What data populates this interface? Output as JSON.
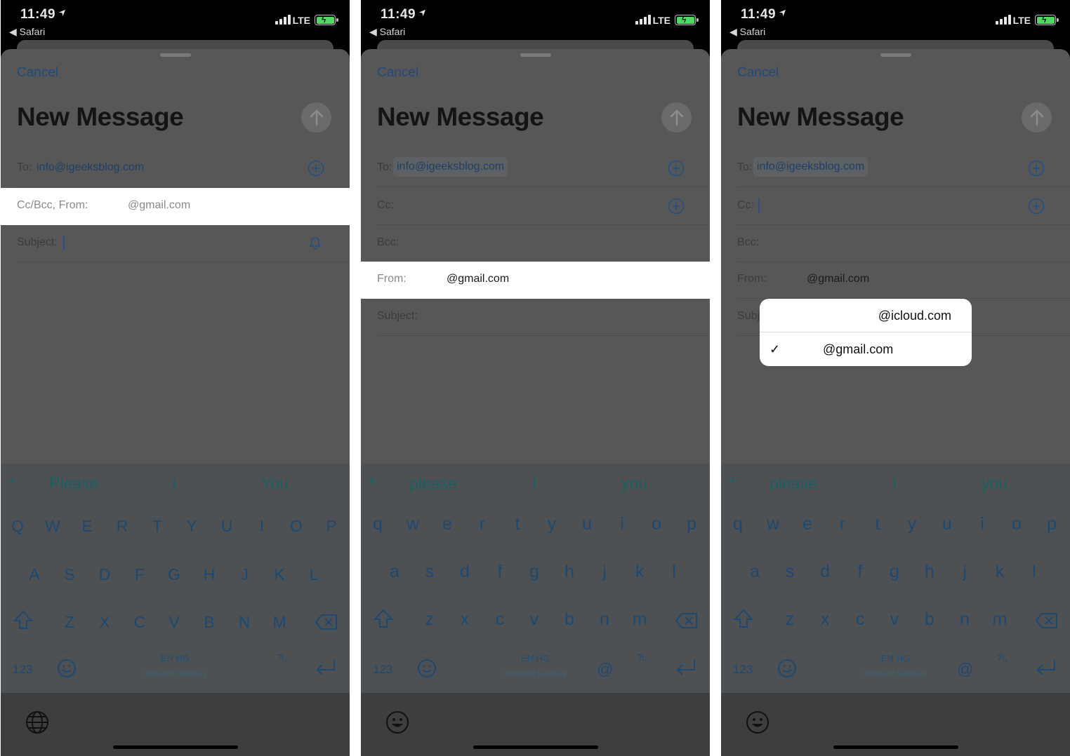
{
  "status": {
    "time": "11:49",
    "back_app": "◀ Safari",
    "network": "LTE"
  },
  "compose": {
    "cancel": "Cancel",
    "title": "New Message",
    "to_label": "To:",
    "to_value": "info@igeeksblog.com",
    "ccbcc_from_label": "Cc/Bcc, From:",
    "from_value": "@gmail.com",
    "cc_label": "Cc:",
    "bcc_label": "Bcc:",
    "from_label": "From:",
    "subject_label": "Subject:",
    "subj_partial": "Subj"
  },
  "popup": {
    "options": [
      "@icloud.com",
      "@gmail.com"
    ],
    "selected_mark": "✓"
  },
  "keyboard": {
    "suggestions_caps": [
      "Please",
      "I",
      "You"
    ],
    "suggestions_lower": [
      "please",
      "I",
      "you"
    ],
    "suggest_plus": "+",
    "row1_upper": [
      "Q",
      "W",
      "E",
      "R",
      "T",
      "Y",
      "U",
      "I",
      "O",
      "P"
    ],
    "row2_upper": [
      "A",
      "S",
      "D",
      "F",
      "G",
      "H",
      "J",
      "K",
      "L"
    ],
    "row3_upper": [
      "Z",
      "X",
      "C",
      "V",
      "B",
      "N",
      "M"
    ],
    "row1_lower": [
      "q",
      "w",
      "e",
      "r",
      "t",
      "y",
      "u",
      "i",
      "o",
      "p"
    ],
    "row2_lower": [
      "a",
      "s",
      "d",
      "f",
      "g",
      "h",
      "j",
      "k",
      "l"
    ],
    "row3_lower": [
      "z",
      "x",
      "c",
      "v",
      "b",
      "n",
      "m"
    ],
    "numbers": "123",
    "language": "EN HG",
    "brand": "Microsoft SwiftKey",
    "at": "@",
    "punct_top": "?!,",
    "punct_bottom": ".",
    "ellipsis": "···"
  },
  "icons": [
    "location-arrow-icon",
    "signal-icon",
    "battery-charging-icon",
    "send-arrow-icon",
    "add-contact-icon",
    "bell-icon",
    "shift-icon",
    "backspace-icon",
    "emoji-icon",
    "return-icon",
    "globe-icon",
    "checkmark-icon"
  ],
  "colors": {
    "link": "#1f4a7a",
    "highlight": "#ffffff",
    "dim_sheet": "#575758",
    "keyboard": "#4e5153"
  }
}
